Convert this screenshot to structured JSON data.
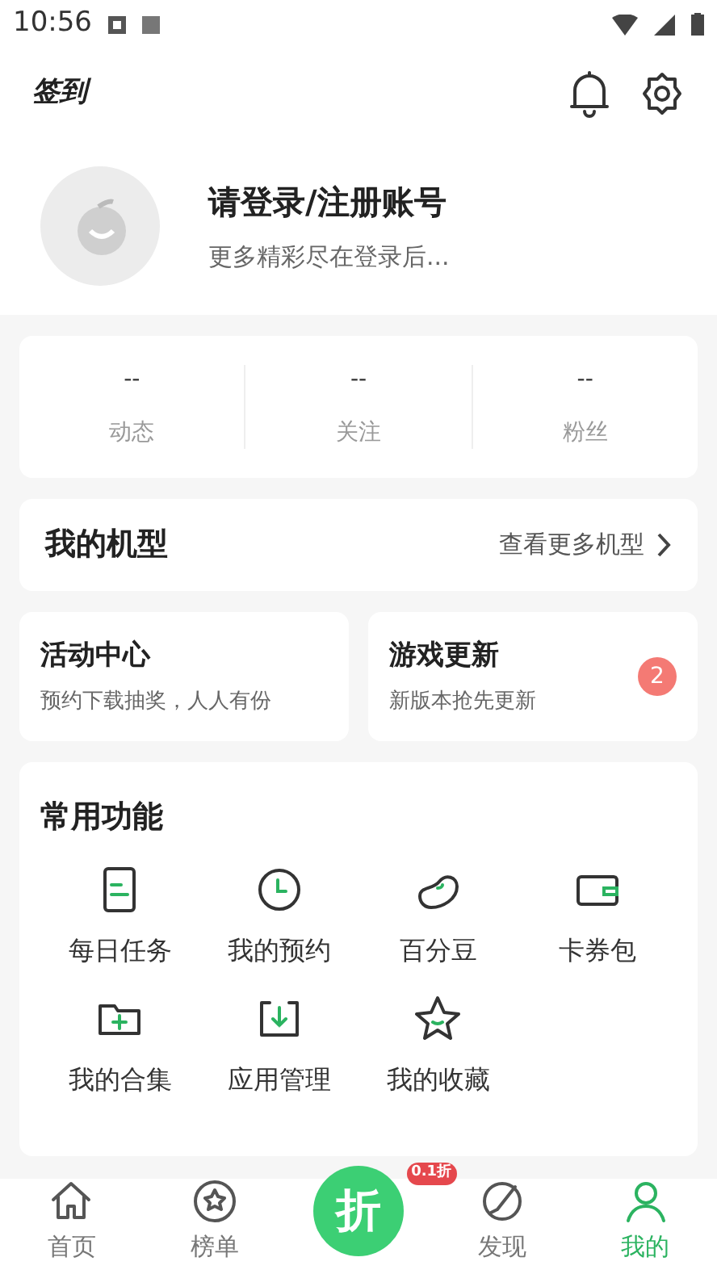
{
  "status_bar": {
    "time": "10:56"
  },
  "header": {
    "logo": "签到"
  },
  "profile": {
    "title": "请登录/注册账号",
    "subtitle": "更多精彩尽在登录后..."
  },
  "stats": [
    {
      "value": "--",
      "label": "动态"
    },
    {
      "value": "--",
      "label": "关注"
    },
    {
      "value": "--",
      "label": "粉丝"
    }
  ],
  "my_models": {
    "title": "我的机型",
    "link": "查看更多机型"
  },
  "promo_cards": [
    {
      "title": "活动中心",
      "subtitle": "预约下载抽奖，人人有份"
    },
    {
      "title": "游戏更新",
      "subtitle": "新版本抢先更新",
      "badge": "2"
    }
  ],
  "functions": {
    "title": "常用功能",
    "items": [
      {
        "kind": "task",
        "label": "每日任务"
      },
      {
        "kind": "clock",
        "label": "我的预约"
      },
      {
        "kind": "bean",
        "label": "百分豆"
      },
      {
        "kind": "wallet",
        "label": "卡券包"
      },
      {
        "kind": "folder",
        "label": "我的合集"
      },
      {
        "kind": "download",
        "label": "应用管理"
      },
      {
        "kind": "star",
        "label": "我的收藏"
      }
    ]
  },
  "bottom_nav": [
    {
      "kind": "home",
      "label": "首页",
      "selected": false
    },
    {
      "kind": "rank",
      "label": "榜单",
      "selected": false
    },
    {
      "kind": "deal",
      "label": "折",
      "badge": "0.1折",
      "selected": false
    },
    {
      "kind": "discover",
      "label": "发现",
      "selected": false
    },
    {
      "kind": "me",
      "label": "我的",
      "selected": true
    }
  ]
}
